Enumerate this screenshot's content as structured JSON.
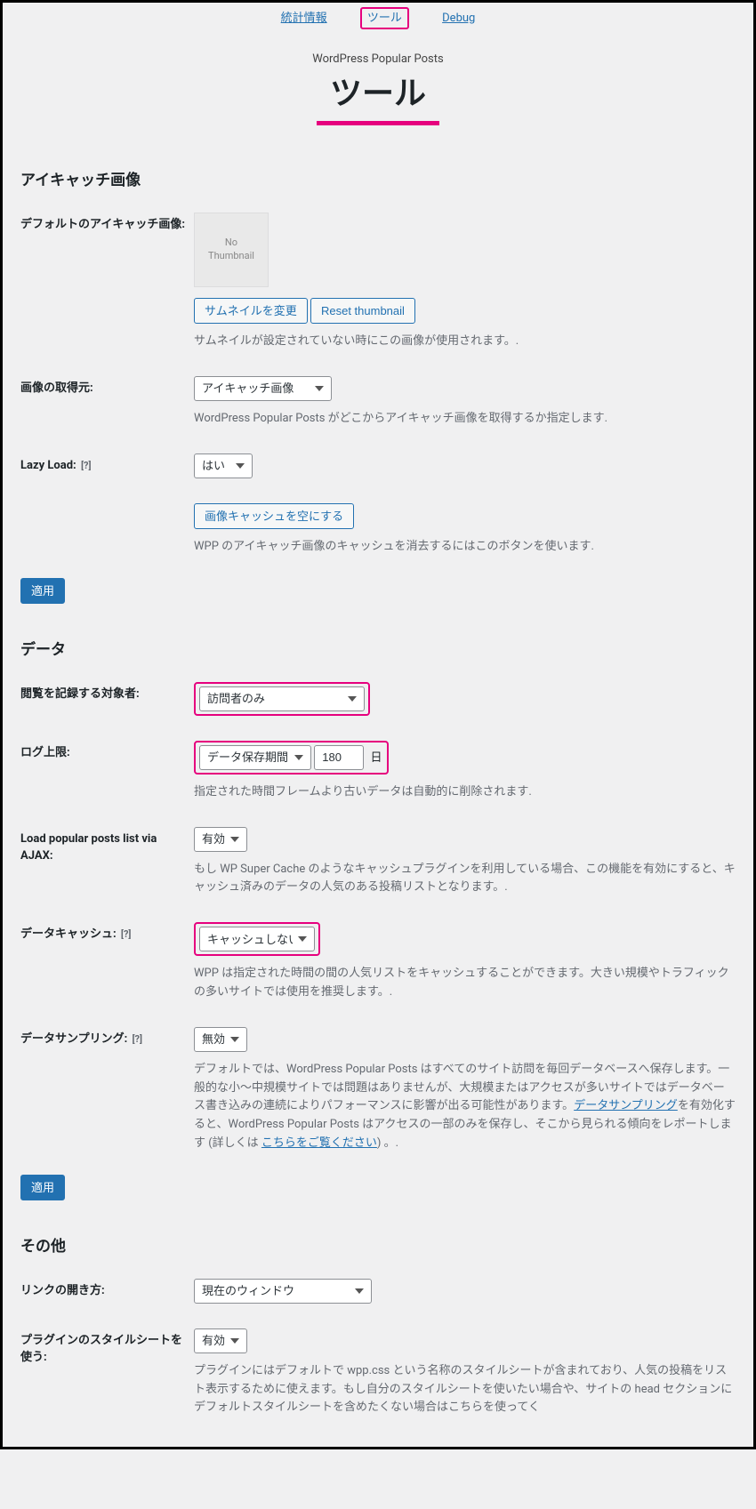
{
  "nav": {
    "stats": "統計情報",
    "tools": "ツール",
    "debug": "Debug"
  },
  "header": {
    "subtitle": "WordPress Popular Posts",
    "title": "ツール"
  },
  "sections": {
    "thumbnail": "アイキャッチ画像",
    "data": "データ",
    "other": "その他"
  },
  "thumb": {
    "default_label": "デフォルトのアイキャッチ画像:",
    "placeholder_text": "No\nThumbnail",
    "change_btn": "サムネイルを変更",
    "reset_btn": "Reset thumbnail",
    "desc": "サムネイルが設定されていない時にこの画像が使用されます。.",
    "source_label": "画像の取得元:",
    "source_select": "アイキャッチ画像",
    "source_desc": "WordPress Popular Posts がどこからアイキャッチ画像を取得するか指定します.",
    "lazy_label": "Lazy Load:",
    "lazy_select": "はい",
    "cache_btn": "画像キャッシュを空にする",
    "cache_desc": "WPP のアイキャッチ画像のキャッシュを消去するにはこのボタンを使います."
  },
  "data": {
    "log_target_label": "閲覧を記録する対象者:",
    "log_target_select": "訪問者のみ",
    "log_limit_label": "ログ上限:",
    "log_limit_select": "データ保存期間",
    "log_limit_value": "180",
    "log_limit_unit": "日",
    "log_limit_desc": "指定された時間フレームより古いデータは自動的に削除されます.",
    "ajax_label": "Load popular posts list via AJAX:",
    "ajax_select": "有効",
    "ajax_desc": "もし WP Super Cache のようなキャッシュプラグインを利用している場合、この機能を有効にすると、キャッシュ済みのデータの人気のある投稿リストとなります。.",
    "cache_label": "データキャッシュ:",
    "cache_select": "キャッシュしない",
    "cache_desc": "WPP は指定された時間の間の人気リストをキャッシュすることができます。大きい規模やトラフィックの多いサイトでは使用を推奨します。.",
    "sampling_label": "データサンプリング:",
    "sampling_select": "無効",
    "sampling_desc_1": "デフォルトでは、WordPress Popular Posts はすべてのサイト訪問を毎回データベースへ保存します。一般的な小〜中規模サイトでは問題はありませんが、大規模またはアクセスが多いサイトではデータベース書き込みの連続によりパフォーマンスに影響が出る可能性があります。",
    "sampling_link_1": "データサンプリング",
    "sampling_desc_2": "を有効化すると、WordPress Popular Posts はアクセスの一部のみを保存し、そこから見られる傾向をレポートします (詳しくは ",
    "sampling_link_2": "こちらをご覧ください",
    "sampling_desc_3": ") 。."
  },
  "other": {
    "link_label": "リンクの開き方:",
    "link_select": "現在のウィンドウ",
    "stylesheet_label": "プラグインのスタイルシートを使う:",
    "stylesheet_select": "有効",
    "stylesheet_desc": "プラグインにはデフォルトで wpp.css という名称のスタイルシートが含まれており、人気の投稿をリスト表示するために使えます。もし自分のスタイルシートを使いたい場合や、サイトの head セクションにデフォルトスタイルシートを含めたくない場合はこちらを使ってく"
  },
  "buttons": {
    "apply": "適用"
  },
  "help_icon": "[?]"
}
